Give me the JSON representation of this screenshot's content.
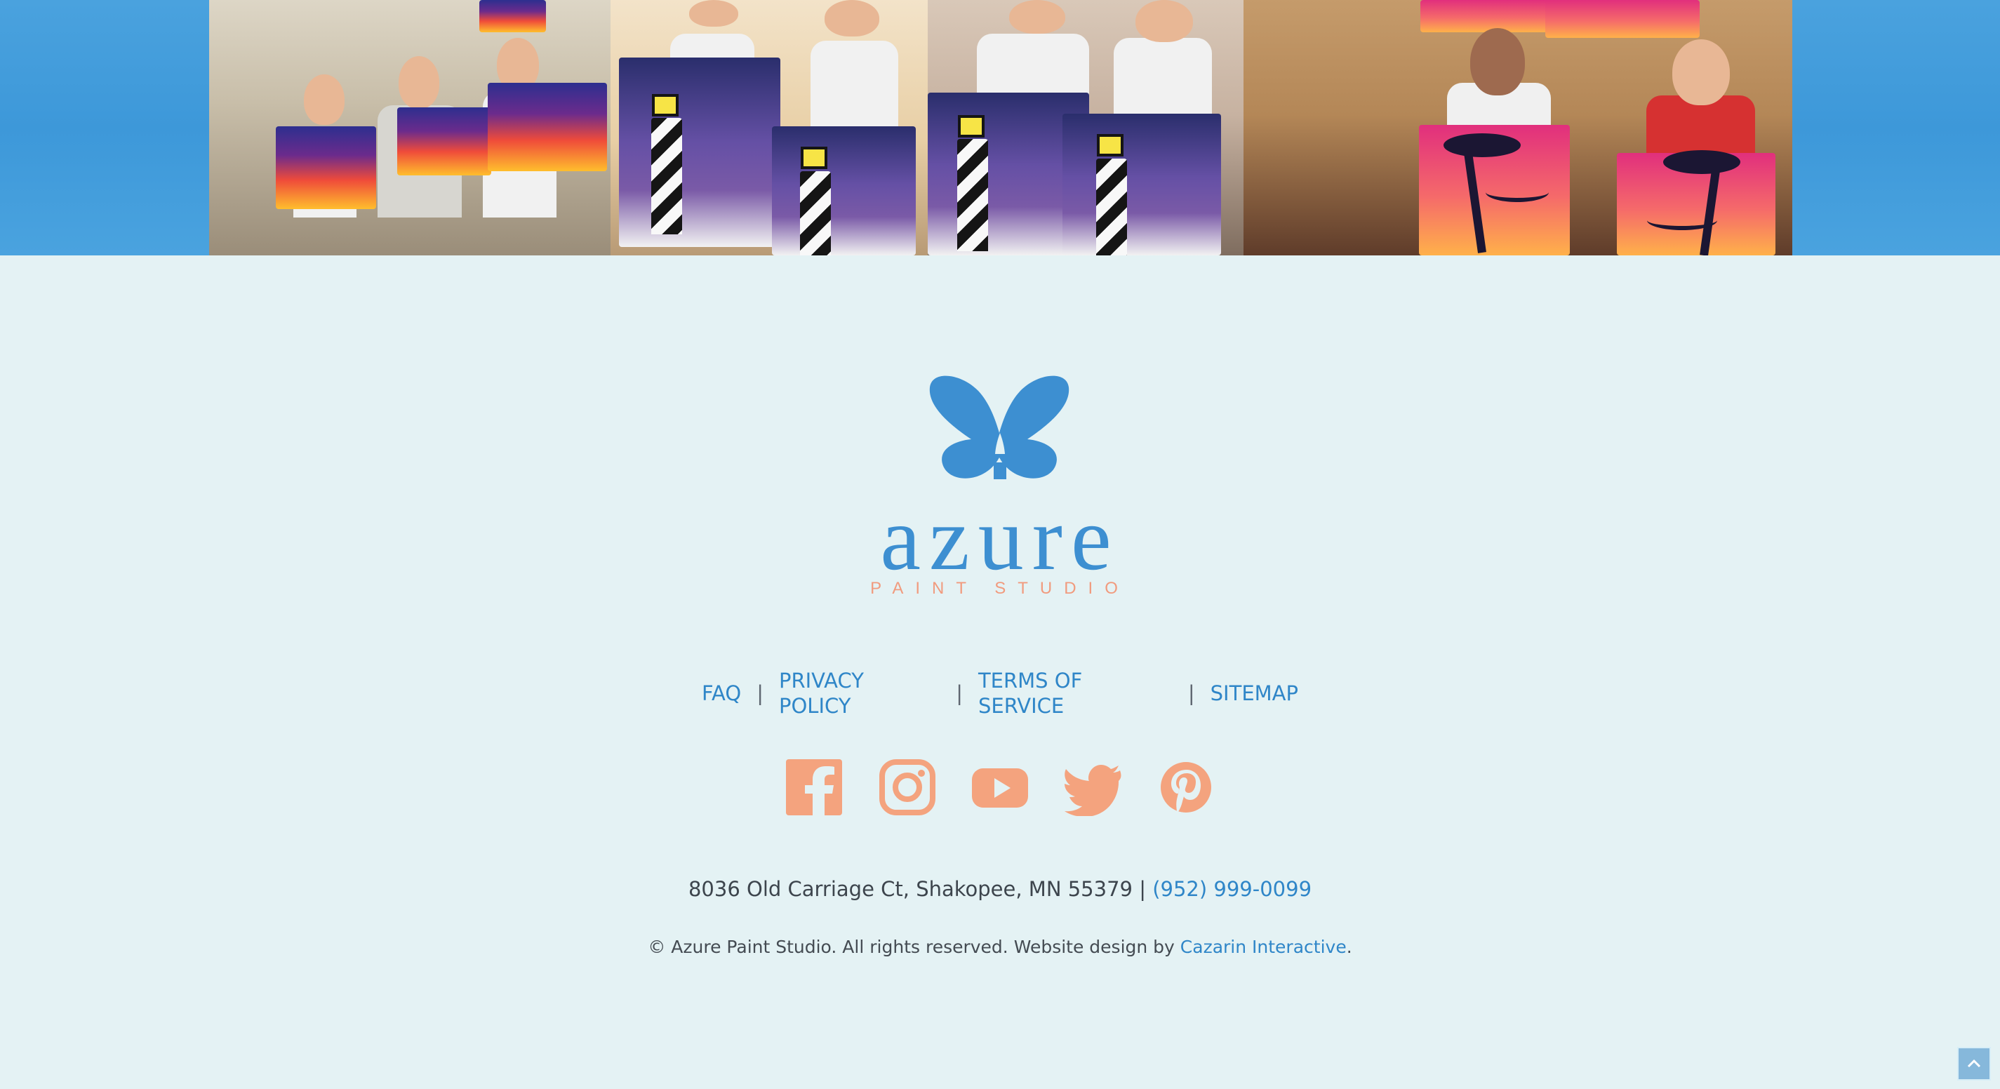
{
  "banner": {
    "image_alt": "Painting class participants holding finished canvases"
  },
  "logo": {
    "wordmark": "azure",
    "subtitle": "PAINT STUDIO",
    "brand_color": "#3d8fd1",
    "accent_color": "#f19b7e",
    "icon": "butterfly-icon"
  },
  "footer": {
    "links": [
      {
        "label": "FAQ"
      },
      {
        "label": "PRIVACY POLICY"
      },
      {
        "label": "TERMS OF SERVICE"
      },
      {
        "label": "SITEMAP"
      }
    ],
    "separator": "|",
    "social": [
      {
        "name": "facebook-icon"
      },
      {
        "name": "instagram-icon"
      },
      {
        "name": "youtube-icon"
      },
      {
        "name": "twitter-icon"
      },
      {
        "name": "pinterest-icon"
      }
    ],
    "address": "8036 Old Carriage Ct, Shakopee, MN 55379 | ",
    "phone": "(952) 999-0099",
    "copyright_prefix": "© Azure Paint Studio. All rights reserved. Website design by ",
    "designer": "Cazarin Interactive",
    "copyright_suffix": "."
  },
  "controls": {
    "back_to_top_icon": "chevron-up-icon"
  },
  "colors": {
    "page_background": "#e4f2f4",
    "banner_blue": "#4aa2de",
    "link_blue": "#2f86c8",
    "social_orange": "#f4a37e"
  }
}
